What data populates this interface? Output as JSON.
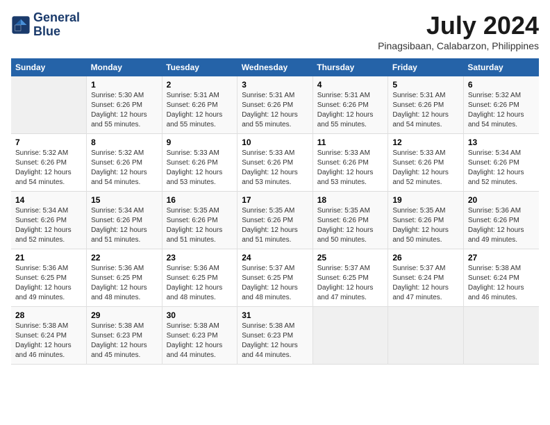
{
  "logo": {
    "line1": "General",
    "line2": "Blue"
  },
  "title": "July 2024",
  "subtitle": "Pinagsibaan, Calabarzon, Philippines",
  "days_header": [
    "Sunday",
    "Monday",
    "Tuesday",
    "Wednesday",
    "Thursday",
    "Friday",
    "Saturday"
  ],
  "weeks": [
    [
      {
        "day": "",
        "info": ""
      },
      {
        "day": "1",
        "info": "Sunrise: 5:30 AM\nSunset: 6:26 PM\nDaylight: 12 hours\nand 55 minutes."
      },
      {
        "day": "2",
        "info": "Sunrise: 5:31 AM\nSunset: 6:26 PM\nDaylight: 12 hours\nand 55 minutes."
      },
      {
        "day": "3",
        "info": "Sunrise: 5:31 AM\nSunset: 6:26 PM\nDaylight: 12 hours\nand 55 minutes."
      },
      {
        "day": "4",
        "info": "Sunrise: 5:31 AM\nSunset: 6:26 PM\nDaylight: 12 hours\nand 55 minutes."
      },
      {
        "day": "5",
        "info": "Sunrise: 5:31 AM\nSunset: 6:26 PM\nDaylight: 12 hours\nand 54 minutes."
      },
      {
        "day": "6",
        "info": "Sunrise: 5:32 AM\nSunset: 6:26 PM\nDaylight: 12 hours\nand 54 minutes."
      }
    ],
    [
      {
        "day": "7",
        "info": "Sunrise: 5:32 AM\nSunset: 6:26 PM\nDaylight: 12 hours\nand 54 minutes."
      },
      {
        "day": "8",
        "info": "Sunrise: 5:32 AM\nSunset: 6:26 PM\nDaylight: 12 hours\nand 54 minutes."
      },
      {
        "day": "9",
        "info": "Sunrise: 5:33 AM\nSunset: 6:26 PM\nDaylight: 12 hours\nand 53 minutes."
      },
      {
        "day": "10",
        "info": "Sunrise: 5:33 AM\nSunset: 6:26 PM\nDaylight: 12 hours\nand 53 minutes."
      },
      {
        "day": "11",
        "info": "Sunrise: 5:33 AM\nSunset: 6:26 PM\nDaylight: 12 hours\nand 53 minutes."
      },
      {
        "day": "12",
        "info": "Sunrise: 5:33 AM\nSunset: 6:26 PM\nDaylight: 12 hours\nand 52 minutes."
      },
      {
        "day": "13",
        "info": "Sunrise: 5:34 AM\nSunset: 6:26 PM\nDaylight: 12 hours\nand 52 minutes."
      }
    ],
    [
      {
        "day": "14",
        "info": "Sunrise: 5:34 AM\nSunset: 6:26 PM\nDaylight: 12 hours\nand 52 minutes."
      },
      {
        "day": "15",
        "info": "Sunrise: 5:34 AM\nSunset: 6:26 PM\nDaylight: 12 hours\nand 51 minutes."
      },
      {
        "day": "16",
        "info": "Sunrise: 5:35 AM\nSunset: 6:26 PM\nDaylight: 12 hours\nand 51 minutes."
      },
      {
        "day": "17",
        "info": "Sunrise: 5:35 AM\nSunset: 6:26 PM\nDaylight: 12 hours\nand 51 minutes."
      },
      {
        "day": "18",
        "info": "Sunrise: 5:35 AM\nSunset: 6:26 PM\nDaylight: 12 hours\nand 50 minutes."
      },
      {
        "day": "19",
        "info": "Sunrise: 5:35 AM\nSunset: 6:26 PM\nDaylight: 12 hours\nand 50 minutes."
      },
      {
        "day": "20",
        "info": "Sunrise: 5:36 AM\nSunset: 6:26 PM\nDaylight: 12 hours\nand 49 minutes."
      }
    ],
    [
      {
        "day": "21",
        "info": "Sunrise: 5:36 AM\nSunset: 6:25 PM\nDaylight: 12 hours\nand 49 minutes."
      },
      {
        "day": "22",
        "info": "Sunrise: 5:36 AM\nSunset: 6:25 PM\nDaylight: 12 hours\nand 48 minutes."
      },
      {
        "day": "23",
        "info": "Sunrise: 5:36 AM\nSunset: 6:25 PM\nDaylight: 12 hours\nand 48 minutes."
      },
      {
        "day": "24",
        "info": "Sunrise: 5:37 AM\nSunset: 6:25 PM\nDaylight: 12 hours\nand 48 minutes."
      },
      {
        "day": "25",
        "info": "Sunrise: 5:37 AM\nSunset: 6:25 PM\nDaylight: 12 hours\nand 47 minutes."
      },
      {
        "day": "26",
        "info": "Sunrise: 5:37 AM\nSunset: 6:24 PM\nDaylight: 12 hours\nand 47 minutes."
      },
      {
        "day": "27",
        "info": "Sunrise: 5:38 AM\nSunset: 6:24 PM\nDaylight: 12 hours\nand 46 minutes."
      }
    ],
    [
      {
        "day": "28",
        "info": "Sunrise: 5:38 AM\nSunset: 6:24 PM\nDaylight: 12 hours\nand 46 minutes."
      },
      {
        "day": "29",
        "info": "Sunrise: 5:38 AM\nSunset: 6:23 PM\nDaylight: 12 hours\nand 45 minutes."
      },
      {
        "day": "30",
        "info": "Sunrise: 5:38 AM\nSunset: 6:23 PM\nDaylight: 12 hours\nand 44 minutes."
      },
      {
        "day": "31",
        "info": "Sunrise: 5:38 AM\nSunset: 6:23 PM\nDaylight: 12 hours\nand 44 minutes."
      },
      {
        "day": "",
        "info": ""
      },
      {
        "day": "",
        "info": ""
      },
      {
        "day": "",
        "info": ""
      }
    ]
  ]
}
